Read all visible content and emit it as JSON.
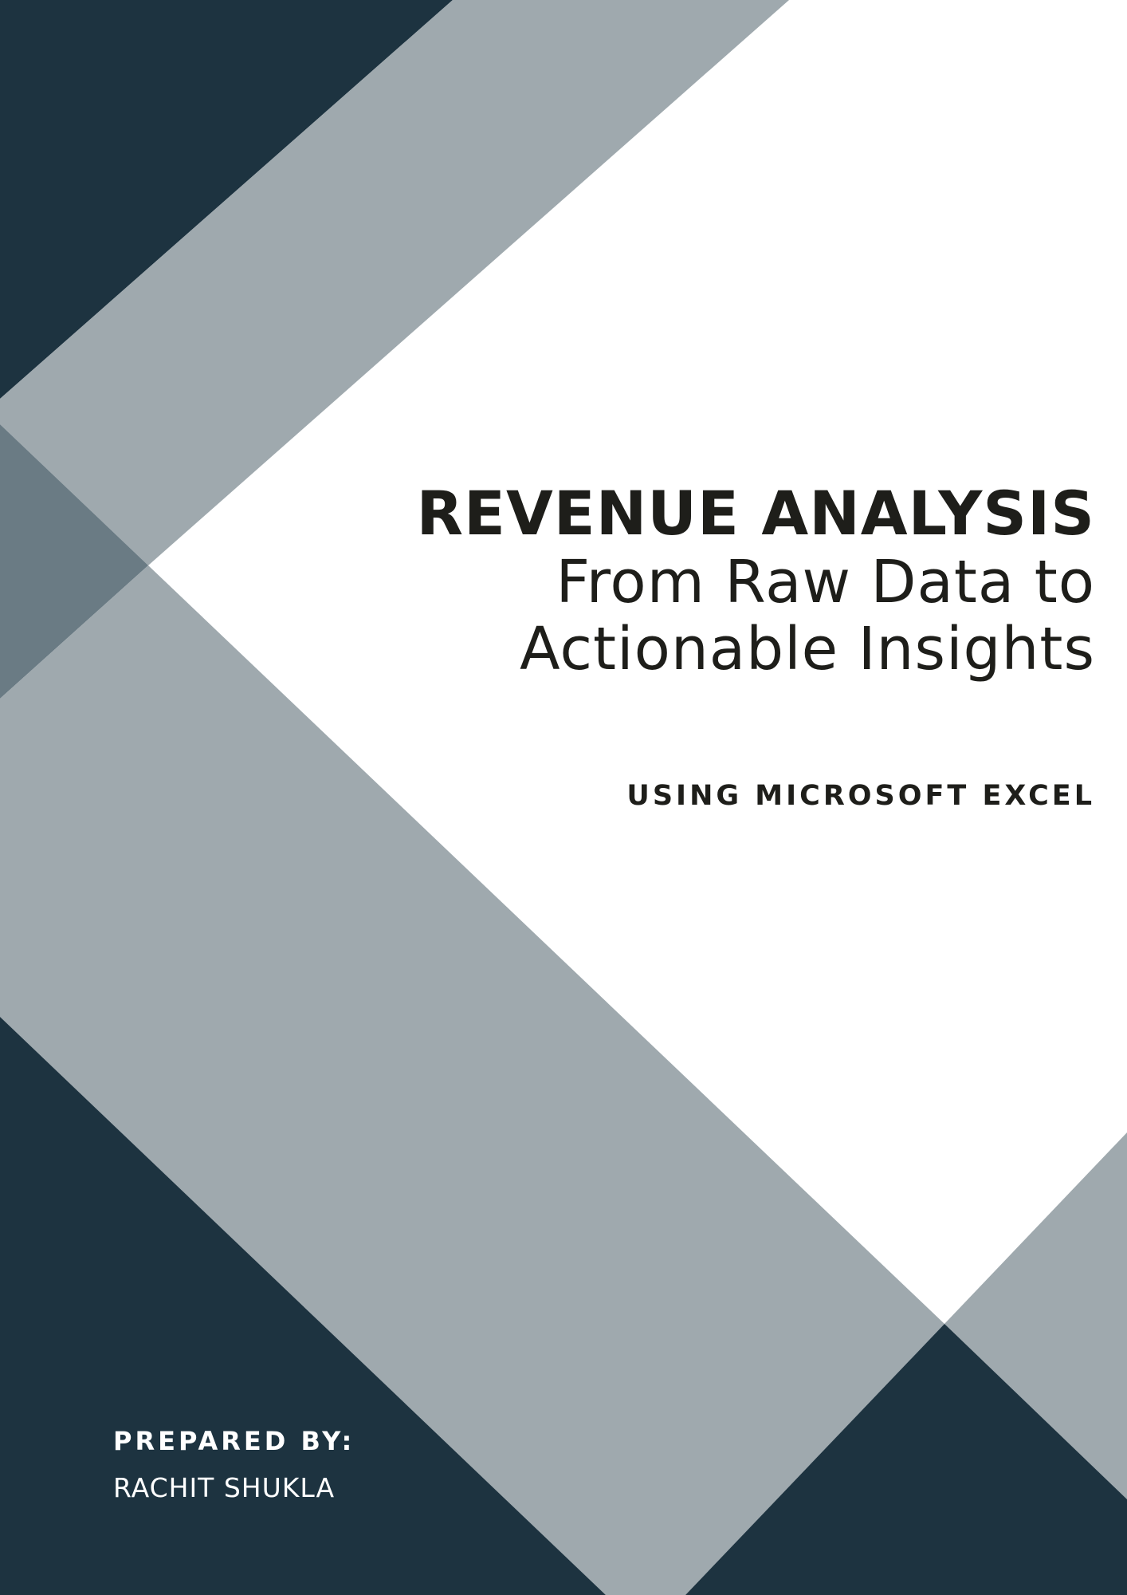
{
  "cover": {
    "title": "REVENUE ANALYSIS",
    "subtitle_line1": "From Raw Data to",
    "subtitle_line2": "Actionable Insights",
    "tagline": "USING MICROSOFT EXCEL",
    "prepared_by_label": "PREPARED BY:",
    "author": "RACHIT SHUKLA"
  },
  "colors": {
    "navy": "#1d3340",
    "gray": "#9fa9ae",
    "slate": "#6a7b84",
    "text": "#1e1e1a",
    "background": "#ffffff"
  }
}
